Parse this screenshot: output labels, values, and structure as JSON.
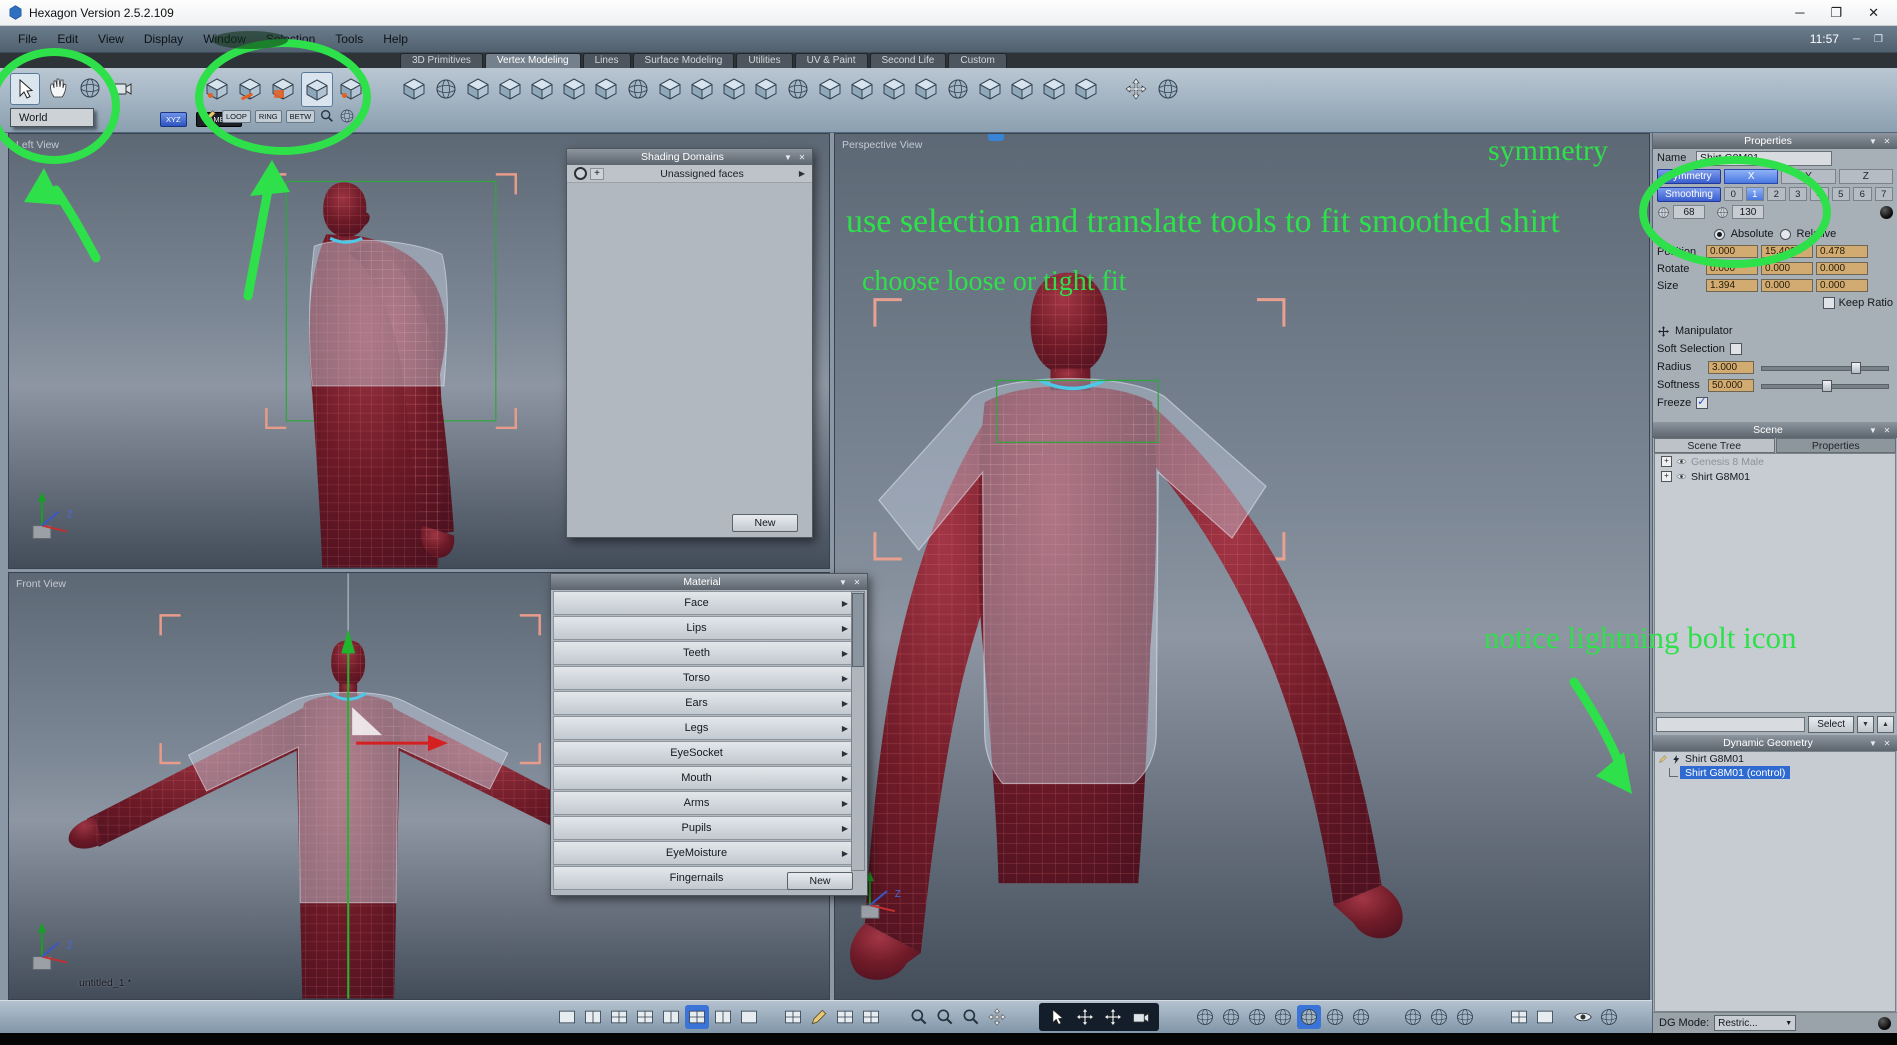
{
  "window": {
    "title": "Hexagon Version 2.5.2.109",
    "time": "11:57"
  },
  "menu": {
    "items": [
      "File",
      "Edit",
      "View",
      "Display",
      "Window",
      "Selection",
      "Tools",
      "Help"
    ]
  },
  "tabs": [
    {
      "label": "3D Primitives"
    },
    {
      "label": "Vertex Modeling"
    },
    {
      "label": "Lines"
    },
    {
      "label": "Surface Modeling"
    },
    {
      "label": "Utilities"
    },
    {
      "label": "UV & Paint"
    },
    {
      "label": "Second Life"
    },
    {
      "label": "Custom"
    }
  ],
  "tools": {
    "world": "World",
    "xyz": "XYZ",
    "camera": "CAMERA",
    "loop": "LOOP",
    "ring": "RING",
    "betw": "BETW"
  },
  "viewports": {
    "left": {
      "label": "Left View"
    },
    "front": {
      "label": "Front View",
      "doc": "untitled_1 *"
    },
    "perspective": {
      "label": "Perspective View"
    }
  },
  "shading_domains": {
    "title": "Shading Domains",
    "row": "Unassigned faces",
    "new": "New"
  },
  "material": {
    "title": "Material",
    "items": [
      "Face",
      "Lips",
      "Teeth",
      "Torso",
      "Ears",
      "Legs",
      "EyeSocket",
      "Mouth",
      "Arms",
      "Pupils",
      "EyeMoisture",
      "Fingernails"
    ],
    "new": "New"
  },
  "properties": {
    "title": "Properties",
    "name_label": "Name",
    "name_value": "Shirt G8M01",
    "symmetry": "Symmetry",
    "axis_x": "X",
    "axis_y": "Y",
    "axis_z": "Z",
    "smoothing": "Smoothing",
    "levels": [
      "0",
      "1",
      "2",
      "3",
      "4",
      "5",
      "6",
      "7"
    ],
    "range_low": "68",
    "range_high": "130",
    "absolute": "Absolute",
    "relative": "Relative",
    "position_label": "Position",
    "rotate_label": "Rotate",
    "size_label": "Size",
    "position": [
      "0.000",
      "15.402",
      "0.478"
    ],
    "rotate": [
      "0.000",
      "0.000",
      "0.000"
    ],
    "size": [
      "1.394",
      "0.000",
      "0.000"
    ],
    "keep_ratio": "Keep Ratio",
    "manipulator": "Manipulator",
    "soft_selection": "Soft Selection",
    "radius_label": "Radius",
    "radius_value": "3.000",
    "softness_label": "Softness",
    "softness_value": "50.000",
    "freeze": "Freeze"
  },
  "scene": {
    "title": "Scene",
    "tab_tree": "Scene Tree",
    "tab_props": "Properties",
    "item1": "Genesis 8 Male",
    "item2": "Shirt G8M01",
    "select": "Select"
  },
  "dynamic_geometry": {
    "title": "Dynamic Geometry",
    "item1": "Shirt G8M01",
    "item2": "Shirt G8M01 (control)",
    "dg_mode": "DG Mode:",
    "dg_value": "Restric..."
  },
  "annotations": {
    "symmetry": "symmetry",
    "line1": "use selection and translate tools to fit smoothed shirt",
    "line2": "choose loose or tight fit",
    "line3": "notice lightning bolt icon",
    "green": "#2ee04a"
  },
  "icons": {
    "collapse": "▼",
    "close": "✕",
    "arrow_right": "▶",
    "minimize": "─",
    "maximize": "❐",
    "plus": "+",
    "up": "▲",
    "down": "▼"
  },
  "colors": {
    "annotation_green": "#2ee04a",
    "body_red": "#7c1f2e",
    "shirt_gray": "#c6cedd",
    "accent_blue": "#4a78e2",
    "value_tan": "#d2ab72"
  }
}
